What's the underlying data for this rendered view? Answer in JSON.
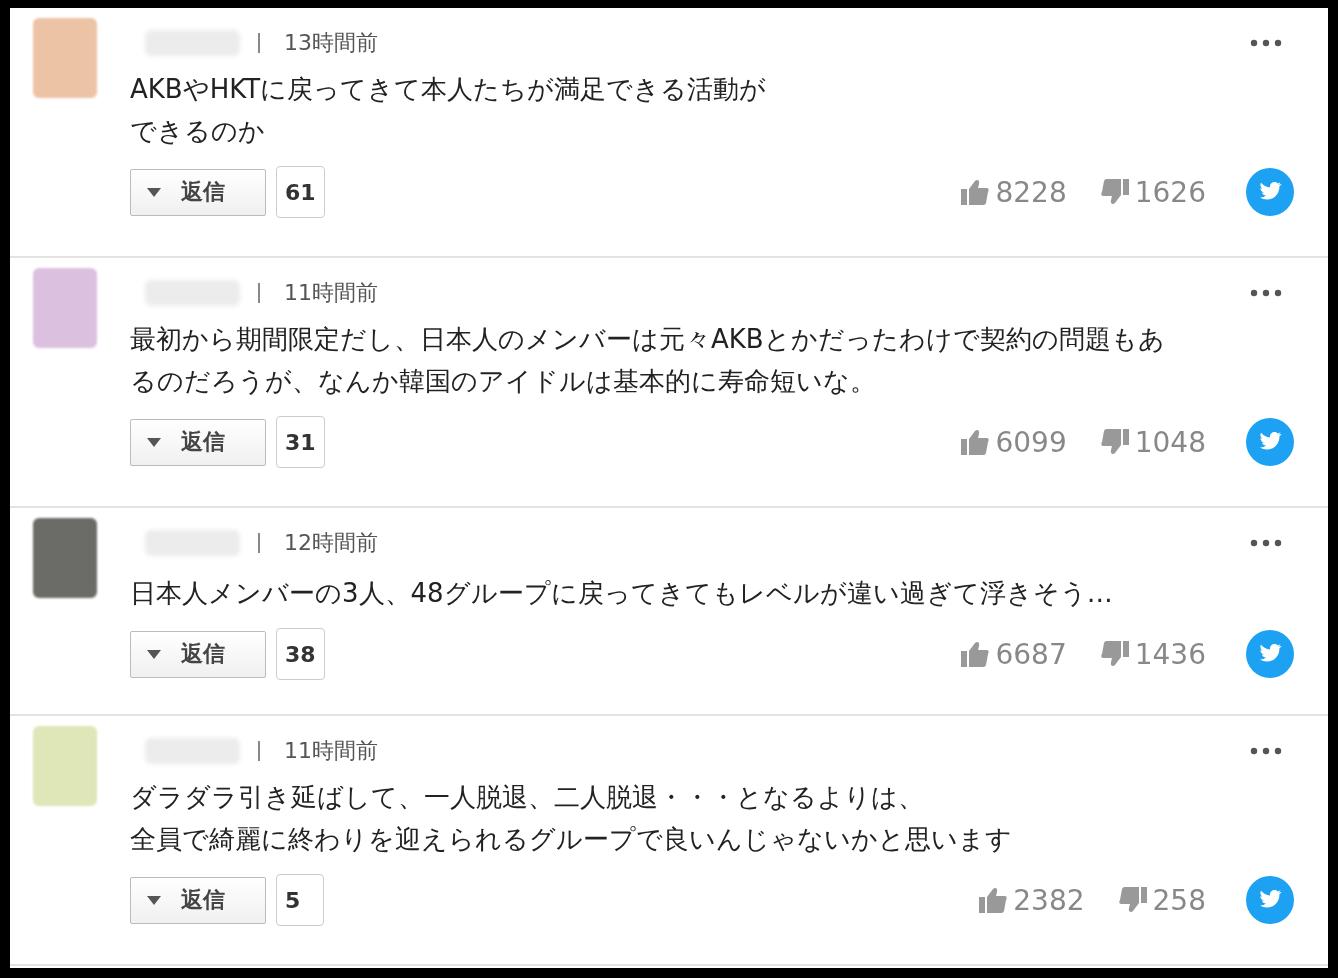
{
  "comments": [
    {
      "avatar": {
        "color": "#edc3a6"
      },
      "time": "13時間前",
      "lines": [
        "AKBやHKTに戻ってきて本人たちが満足できる活動が",
        "できるのか"
      ],
      "reply_label": "返信",
      "reply_count": "61",
      "likes": "8228",
      "dislikes": "1626"
    },
    {
      "avatar": {
        "color": "#dcc0e0"
      },
      "time": "11時間前",
      "lines": [
        "最初から期間限定だし、日本人のメンバーは元々AKBとかだったわけで契約の問題もあ",
        "るのだろうが、なんか韓国のアイドルは基本的に寿命短いな。"
      ],
      "reply_label": "返信",
      "reply_count": "31",
      "likes": "6099",
      "dislikes": "1048"
    },
    {
      "avatar": {
        "color": "#6b6c67"
      },
      "time": "12時間前",
      "lines": [
        "日本人メンバーの3人、48グループに戻ってきてもレベルが違い過ぎて浮きそう…"
      ],
      "reply_label": "返信",
      "reply_count": "38",
      "likes": "6687",
      "dislikes": "1436"
    },
    {
      "avatar": {
        "color": "#dfe6b8"
      },
      "time": "11時間前",
      "lines": [
        "ダラダラ引き延ばして、一人脱退、二人脱退・・・となるよりは、",
        "全員で綺麗に終わりを迎えられるグループで良いんじゃないかと思います"
      ],
      "reply_label": "返信",
      "reply_count": "5",
      "likes": "2382",
      "dislikes": "258"
    }
  ]
}
